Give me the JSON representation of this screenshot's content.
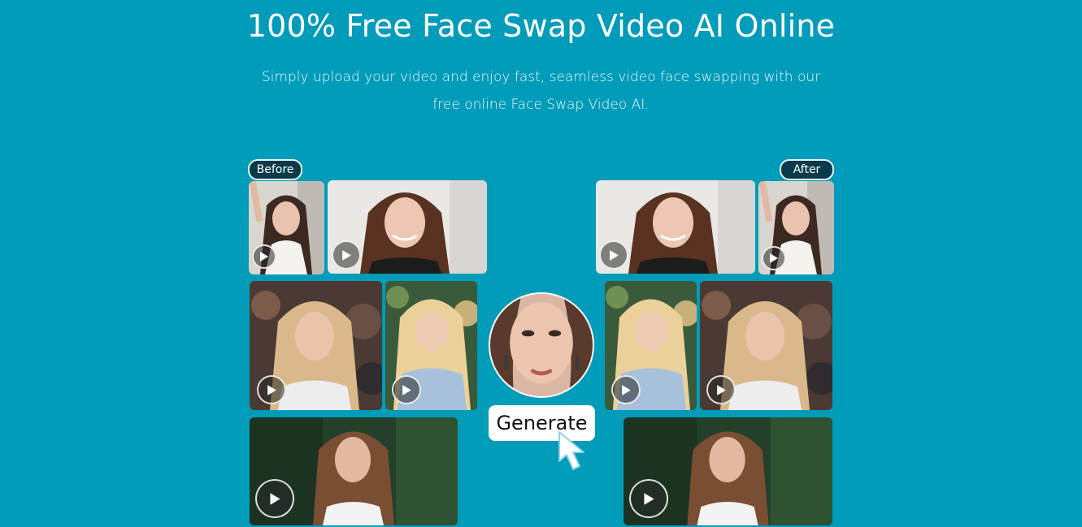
{
  "hero": {
    "title": "100% Free Face Swap Video AI Online",
    "subtitle": "Simply upload your video and enjoy fast, seamless video face swapping with our free online Face Swap Video AI."
  },
  "labels": {
    "before": "Before",
    "after": "After"
  },
  "generate_label": "Generate",
  "colors": {
    "background": "#019cb9",
    "pill_background": "#0b3a4a",
    "text": "#ffffff"
  },
  "icons": {
    "play": "play-icon",
    "cursor": "hand-pointer-icon"
  }
}
